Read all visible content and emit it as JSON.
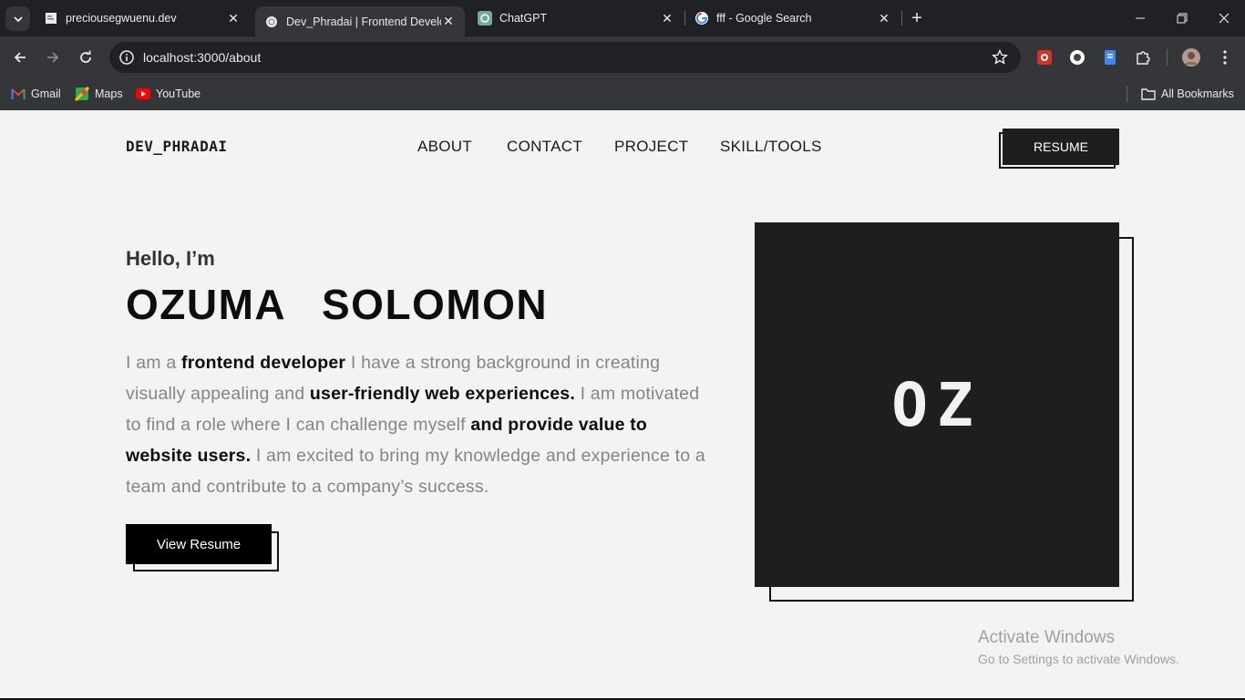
{
  "browser": {
    "tabs": [
      {
        "title": "preciousegwuenu.dev",
        "favicon": "document-icon"
      },
      {
        "title": "Dev_Phradai | Frontend Developer",
        "favicon": "globe-icon",
        "active": true
      },
      {
        "title": "ChatGPT",
        "favicon": "openai-icon"
      },
      {
        "title": "fff - Google Search",
        "favicon": "google-icon"
      }
    ],
    "url": "localhost:3000/about",
    "bookmarks": [
      {
        "label": "Gmail",
        "icon": "gmail-icon"
      },
      {
        "label": "Maps",
        "icon": "maps-icon"
      },
      {
        "label": "YouTube",
        "icon": "youtube-icon"
      }
    ],
    "all_bookmarks": "All Bookmarks"
  },
  "site": {
    "logo": "DEV_PHRADAI",
    "nav": [
      "ABOUT",
      "CONTACT",
      "PROJECT",
      "SKILL/TOOLS"
    ],
    "resume_button": "RESUME"
  },
  "hero": {
    "greeting": "Hello, I’m",
    "name": "OZUMA  SOLOMON",
    "bio": [
      {
        "text": "I am a ",
        "bold": false
      },
      {
        "text": "frontend developer",
        "bold": true
      },
      {
        "text": " I have a strong background in creating visually appealing and ",
        "bold": false
      },
      {
        "text": "user-friendly web experiences.",
        "bold": true
      },
      {
        "text": " I am motivated to find a role where I can challenge myself ",
        "bold": false
      },
      {
        "text": "and provide value to website users.",
        "bold": true
      },
      {
        "text": " I am excited to bring my knowledge and experience to a team and contribute to a company’s success.",
        "bold": false
      }
    ],
    "view_resume": "View Resume",
    "initials": "OZ"
  },
  "watermark": {
    "title": "Activate Windows",
    "subtitle": "Go to Settings to activate Windows."
  }
}
